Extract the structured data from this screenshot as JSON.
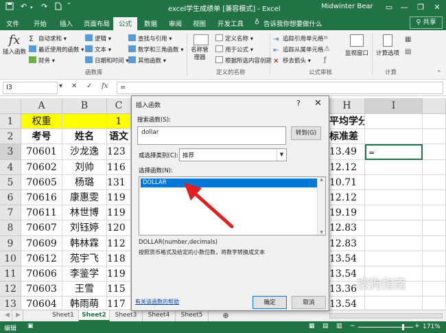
{
  "window": {
    "title": "excel学生成绩单 [兼容模式] - Excel",
    "user": "Midwinter Bear",
    "share": "共享"
  },
  "tabs": [
    "文件",
    "开始",
    "插入",
    "页面布局",
    "公式",
    "数据",
    "审阅",
    "视图",
    "开发工具"
  ],
  "active_tab": "公式",
  "tell_me": "告诉我你想要做什么",
  "ribbon": {
    "insert_function": "插入函数",
    "lib_col1": [
      "自动求和",
      "最近使用的函数",
      "财务"
    ],
    "lib_col2": [
      "逻辑",
      "文本",
      "日期和时间"
    ],
    "lib_col3": [
      "查找与引用",
      "数学和三角函数",
      "其他函数"
    ],
    "group_library": "函数库",
    "name_manager": "名称管理器",
    "names_items": [
      "定义名称",
      "用于公式",
      "根据所选内容创建"
    ],
    "group_names": "定义的名称",
    "audit_items": [
      "追踪引用单元格",
      "追踪从属单元格",
      "移去箭头"
    ],
    "group_audit": "公式审核",
    "watch_window": "监视窗口",
    "calc_options": "计算选项",
    "group_calc": "计算"
  },
  "formula_bar": {
    "name_box": "I3",
    "formula": "="
  },
  "grid": {
    "columns": [
      "A",
      "B",
      "C",
      "H",
      "I"
    ],
    "rows": [
      "1",
      "2",
      "3",
      "4",
      "5",
      "6",
      "7",
      "8",
      "9",
      "10",
      "11",
      "12",
      "13"
    ],
    "row1": {
      "a": "权重",
      "c": "1",
      "h": "平均学分"
    },
    "row2": {
      "a": "考号",
      "b": "姓名",
      "c": "语文",
      "h": "标准差"
    },
    "data": [
      {
        "a": "70601",
        "b": "沙龙逸",
        "c": "123",
        "h": "13.49"
      },
      {
        "a": "70602",
        "b": "刘帅",
        "c": "116",
        "h": "12.12"
      },
      {
        "a": "70605",
        "b": "杨璐",
        "c": "131",
        "h": "10.71"
      },
      {
        "a": "70616",
        "b": "康惠雯",
        "c": "119",
        "h": "12.12"
      },
      {
        "a": "70611",
        "b": "林世博",
        "c": "119",
        "h": "19.19"
      },
      {
        "a": "70607",
        "b": "刘钰婷",
        "c": "120",
        "h": "12.83"
      },
      {
        "a": "70609",
        "b": "韩林霖",
        "c": "112",
        "h": "12.83"
      },
      {
        "a": "70612",
        "b": "苑宇飞",
        "c": "118",
        "h": "13.54"
      },
      {
        "a": "70606",
        "b": "李鉴学",
        "c": "119",
        "h": "13.54"
      },
      {
        "a": "70603",
        "b": "王雪",
        "c": "115",
        "h": "13.36"
      },
      {
        "a": "70604",
        "b": "韩雨萌",
        "c": "117",
        "h": "13.54"
      }
    ],
    "active_cell_value": "="
  },
  "sheets": [
    "Sheet1",
    "Sheet2",
    "Sheet3",
    "Sheet4",
    "Sheet5"
  ],
  "active_sheet": "Sheet2",
  "status": {
    "mode": "编辑",
    "zoom": "171%"
  },
  "dialog": {
    "title": "插入函数",
    "search_label": "搜索函数(S):",
    "search_value": "dollar",
    "go_button": "转到(G)",
    "category_label": "或选择类别(C):",
    "category_value": "推荐",
    "select_label": "选择函数(N):",
    "selected_function": "DOLLAR",
    "signature": "DOLLAR(number,decimals)",
    "description": "按照货币格式及给定的小数位数，将数字转换成文本",
    "help_link": "有关该函数的帮助",
    "ok": "确定",
    "cancel": "取消"
  },
  "watermark": "搜狗指南",
  "colors": {
    "excel_green": "#217346",
    "highlight_yellow": "#ffff00",
    "arrow_red": "#e02020",
    "selection_blue": "#0078d7"
  }
}
